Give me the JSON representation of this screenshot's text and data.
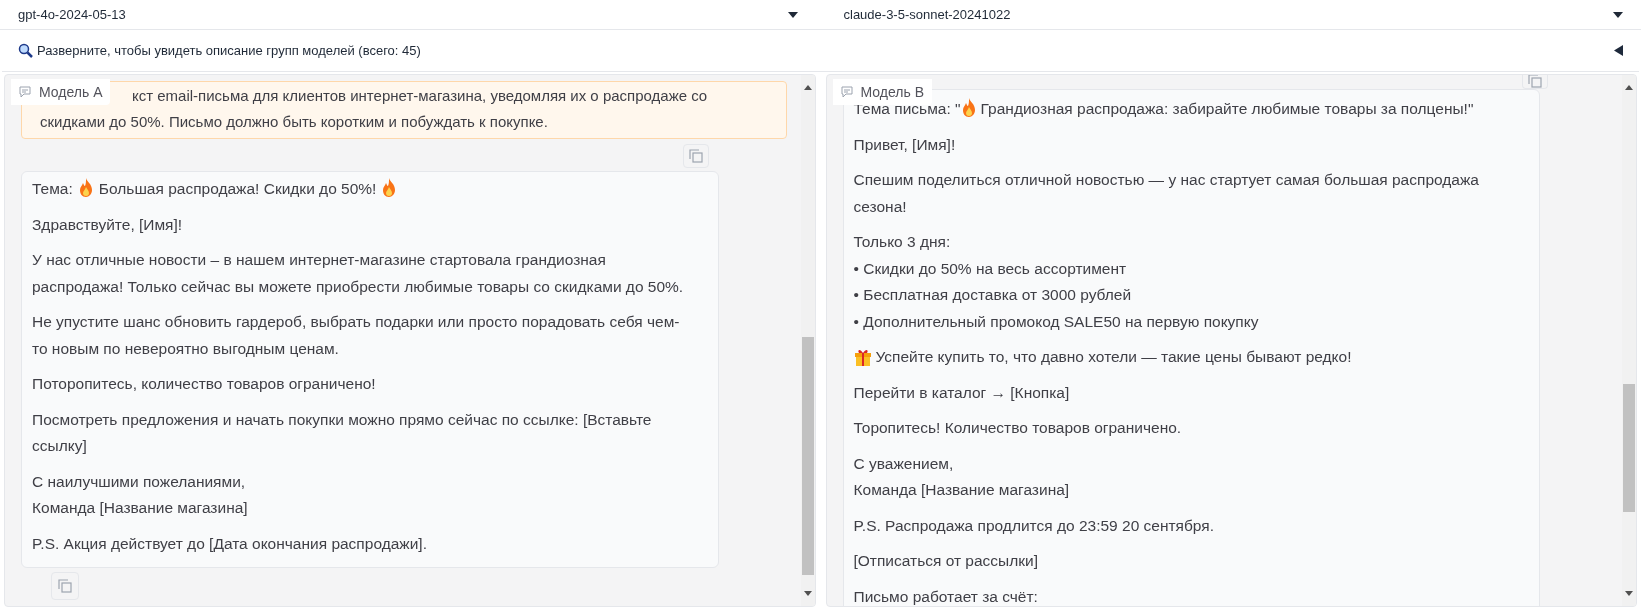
{
  "model_selectors": [
    {
      "value": "gpt-4o-2024-05-13"
    },
    {
      "value": "claude-3-5-sonnet-20241022"
    }
  ],
  "accordion": {
    "label": "Разверните, чтобы увидеть описание групп моделей (всего: 45)",
    "expanded": false
  },
  "panels": [
    {
      "label": "Модель A",
      "prompt": {
        "lines": [
          "кст email-письма для клиентов интернет-магазина, уведомляя их о распродаже со",
          "скидками до 50%. Письмо должно быть коротким и побуждать к покупке."
        ]
      },
      "response": {
        "paragraphs": [
          {
            "kind": "flame_both",
            "prefix": "Тема:",
            "text": "Большая распродажа! Скидки до 50%!"
          },
          {
            "kind": "text",
            "lines": [
              "Здравствуйте, [Имя]!"
            ]
          },
          {
            "kind": "text",
            "lines": [
              "У нас отличные новости – в нашем интернет-магазине стартовала грандиозная распродажа! Только сейчас вы можете приобрести любимые товары со скидками до 50%."
            ]
          },
          {
            "kind": "text",
            "lines": [
              "Не упустите шанс обновить гардероб, выбрать подарки или просто порадовать себя чем-то новым по невероятно выгодным ценам."
            ]
          },
          {
            "kind": "text",
            "lines": [
              "Поторопитесь, количество товаров ограничено!"
            ]
          },
          {
            "kind": "text",
            "lines": [
              "Посмотреть предложения и начать покупки можно прямо сейчас по ссылке: [Вставьте ссылку]"
            ]
          },
          {
            "kind": "text",
            "lines": [
              "С наилучшими пожеланиями,",
              "Команда [Название магазина]"
            ]
          },
          {
            "kind": "text",
            "lines": [
              "P.S. Акция действует до [Дата окончания распродажи]."
            ]
          }
        ]
      }
    },
    {
      "label": "Модель B",
      "response": {
        "paragraphs": [
          {
            "kind": "flame_lead",
            "prefix": "Тема письма: \"",
            "text": "Грандиозная распродажа: забирайте любимые товары за полцены!\""
          },
          {
            "kind": "text",
            "lines": [
              "Привет, [Имя]!"
            ]
          },
          {
            "kind": "text",
            "lines": [
              "Спешим поделиться отличной новостью — у нас стартует самая большая распродажа сезона!"
            ]
          },
          {
            "kind": "text",
            "lines": [
              "Только 3 дня:",
              "• Скидки до 50% на весь ассортимент",
              "• Бесплатная доставка от 3000 рублей",
              "• Дополнительный промокод SALE50 на первую покупку"
            ]
          },
          {
            "kind": "gift",
            "text": "Успейте купить то, что давно хотели — такие цены бывают редко!"
          },
          {
            "kind": "text",
            "lines": [
              "Перейти в каталог → [Кнопка]"
            ]
          },
          {
            "kind": "text",
            "lines": [
              "Торопитесь! Количество товаров ограничено."
            ]
          },
          {
            "kind": "text",
            "lines": [
              "С уважением,",
              "Команда [Название магазина]"
            ]
          },
          {
            "kind": "text",
            "lines": [
              "P.S. Распродажа продлится до 23:59 20 сентября."
            ]
          },
          {
            "kind": "text",
            "lines": [
              "[Отписаться от рассылки]"
            ]
          },
          {
            "kind": "text",
            "lines": [
              "Письмо работает за счёт:"
            ]
          }
        ]
      }
    }
  ]
}
